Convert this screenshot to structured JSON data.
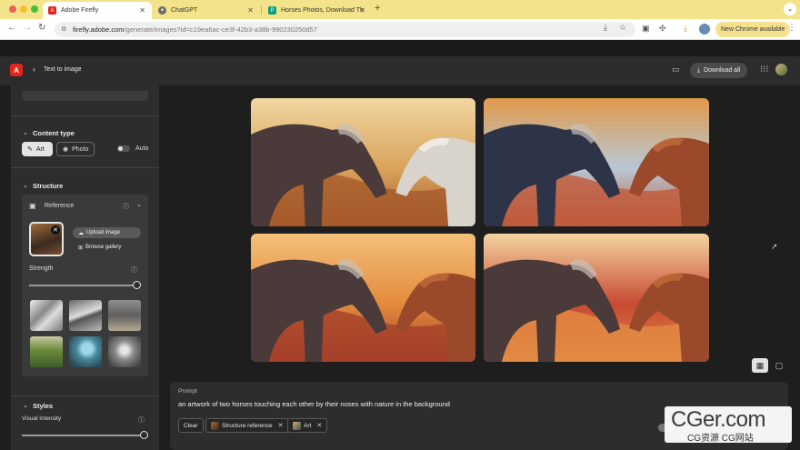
{
  "browser": {
    "tabs": [
      {
        "label": "Adobe Firefly",
        "active": true,
        "favicon_color": "#e1251b"
      },
      {
        "label": "ChatGPT",
        "active": false,
        "favicon_color": "#6b6b6b"
      },
      {
        "label": "Horses Photos, Download Th",
        "active": false,
        "favicon_color": "#05a081"
      }
    ],
    "traffic_lights": [
      "#ee5f57",
      "#f6bd2e",
      "#3fc13b"
    ],
    "url_host": "firefly.adobe.com",
    "url_path": "/generate/images?id=c19ea6ac-ce3f-42b3-a38b-990230250d57",
    "new_chrome_label": "New Chrome available"
  },
  "header": {
    "page_title": "Text to image",
    "download_all_label": "Download all",
    "logo_letter": "A"
  },
  "sidebar": {
    "content_type": {
      "heading": "Content type",
      "art_label": "Art",
      "photo_label": "Photo",
      "auto_label": "Auto",
      "selected": "Art"
    },
    "structure": {
      "heading": "Structure",
      "reference_label": "Reference",
      "upload_label": "Upload image",
      "browse_label": "Browse gallery",
      "strength_label": "Strength",
      "strength_value": 1.0
    },
    "styles": {
      "heading": "Styles",
      "visual_intensity_label": "Visual intensity",
      "visual_intensity_value": 1.0
    }
  },
  "gallery": {
    "images": [
      {
        "name": "generated-image-1",
        "palette": [
          "#d9a35c",
          "#a65a2a",
          "#f1d6a0"
        ]
      },
      {
        "name": "generated-image-2",
        "palette": [
          "#b8c7d6",
          "#c05a3a",
          "#e09a4a"
        ]
      },
      {
        "name": "generated-image-3",
        "palette": [
          "#e38a3c",
          "#a5402a",
          "#f4c07a"
        ]
      },
      {
        "name": "generated-image-4",
        "palette": [
          "#c74a32",
          "#e28a44",
          "#f3d3a0"
        ]
      }
    ],
    "view_mode": "grid"
  },
  "prompt": {
    "label": "Prompt",
    "text": "an artwork of two horses touching each other by their noses with nature in the background",
    "clear_label": "Clear",
    "chips": [
      {
        "label": "Structure reference"
      },
      {
        "label": "Art"
      }
    ]
  },
  "watermark": {
    "big": "CGer.com",
    "small": "CG资源 CG网站"
  }
}
